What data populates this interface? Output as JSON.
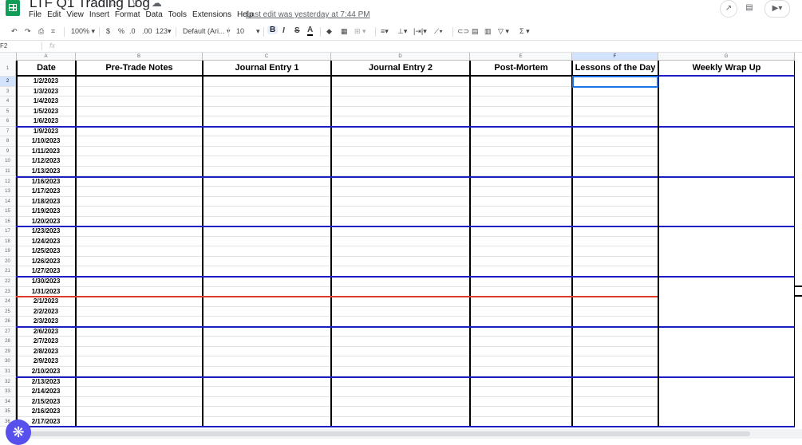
{
  "app": {
    "doc_title": "LTF Q1 Trading Log",
    "title_icons": "☆ ⇪ ☁",
    "last_edit": "Last edit was yesterday at 7:44 PM"
  },
  "menu": [
    "File",
    "Edit",
    "View",
    "Insert",
    "Format",
    "Data",
    "Tools",
    "Extensions",
    "Help"
  ],
  "toolbar": {
    "undo": "↶",
    "redo": "↷",
    "print": "⎙",
    "paint_format": "⌗",
    "zoom": "100%",
    "currency": "$",
    "percent": "%",
    "dec_decrease": ".0",
    "dec_increase": ".00",
    "more_formats": "123",
    "font": "Default (Ari...",
    "font_size": "10",
    "bold": "B",
    "italic": "I",
    "strike": "S",
    "text_color": "A",
    "fill_color": "◆",
    "borders": "▦",
    "merge": "⊞",
    "align_h": "≡",
    "align_v": "⊥",
    "wrap": "|⇥|",
    "rotate": "⟋",
    "link": "⊂⊃",
    "comment": "▤",
    "chart": "▥",
    "filter": "▽",
    "functions": "Σ"
  },
  "formula_bar": {
    "name_box": "F2",
    "fx": "fx"
  },
  "columns": [
    {
      "letter": "A",
      "header": "Date"
    },
    {
      "letter": "B",
      "header": "Pre-Trade Notes"
    },
    {
      "letter": "C",
      "header": "Journal Entry 1"
    },
    {
      "letter": "D",
      "header": "Journal Entry 2"
    },
    {
      "letter": "E",
      "header": "Post-Mortem"
    },
    {
      "letter": "F",
      "header": "Lessons of the Day"
    },
    {
      "letter": "G",
      "header": "Weekly Wrap Up"
    }
  ],
  "row_numbers": [
    "1",
    "2",
    "3",
    "4",
    "5",
    "6",
    "7",
    "8",
    "9",
    "10",
    "11",
    "12",
    "13",
    "14",
    "15",
    "16",
    "17",
    "18",
    "19",
    "20",
    "21",
    "22",
    "23",
    "24",
    "25",
    "26",
    "27",
    "28",
    "29",
    "30",
    "31",
    "32",
    "33",
    "34",
    "35",
    "36"
  ],
  "dates": [
    "1/2/2023",
    "1/3/2023",
    "1/4/2023",
    "1/5/2023",
    "1/6/2023",
    "1/9/2023",
    "1/10/2023",
    "1/11/2023",
    "1/12/2023",
    "1/13/2023",
    "1/16/2023",
    "1/17/2023",
    "1/18/2023",
    "1/19/2023",
    "1/20/2023",
    "1/23/2023",
    "1/24/2023",
    "1/25/2023",
    "1/26/2023",
    "1/27/2023",
    "1/30/2023",
    "1/31/2023",
    "2/1/2023",
    "2/2/2023",
    "2/3/2023",
    "2/6/2023",
    "2/7/2023",
    "2/8/2023",
    "2/9/2023",
    "2/10/2023",
    "2/13/2023",
    "2/14/2023",
    "2/15/2023",
    "2/16/2023",
    "2/17/2023"
  ],
  "selected_cell": "F2",
  "colors": {
    "week_border": "#1d1dc4",
    "month_border": "#e03a2a",
    "selection": "#1a73e8",
    "sheets_green": "#0f9d58",
    "fab": "#5850ec"
  },
  "fab_icon": "❋"
}
